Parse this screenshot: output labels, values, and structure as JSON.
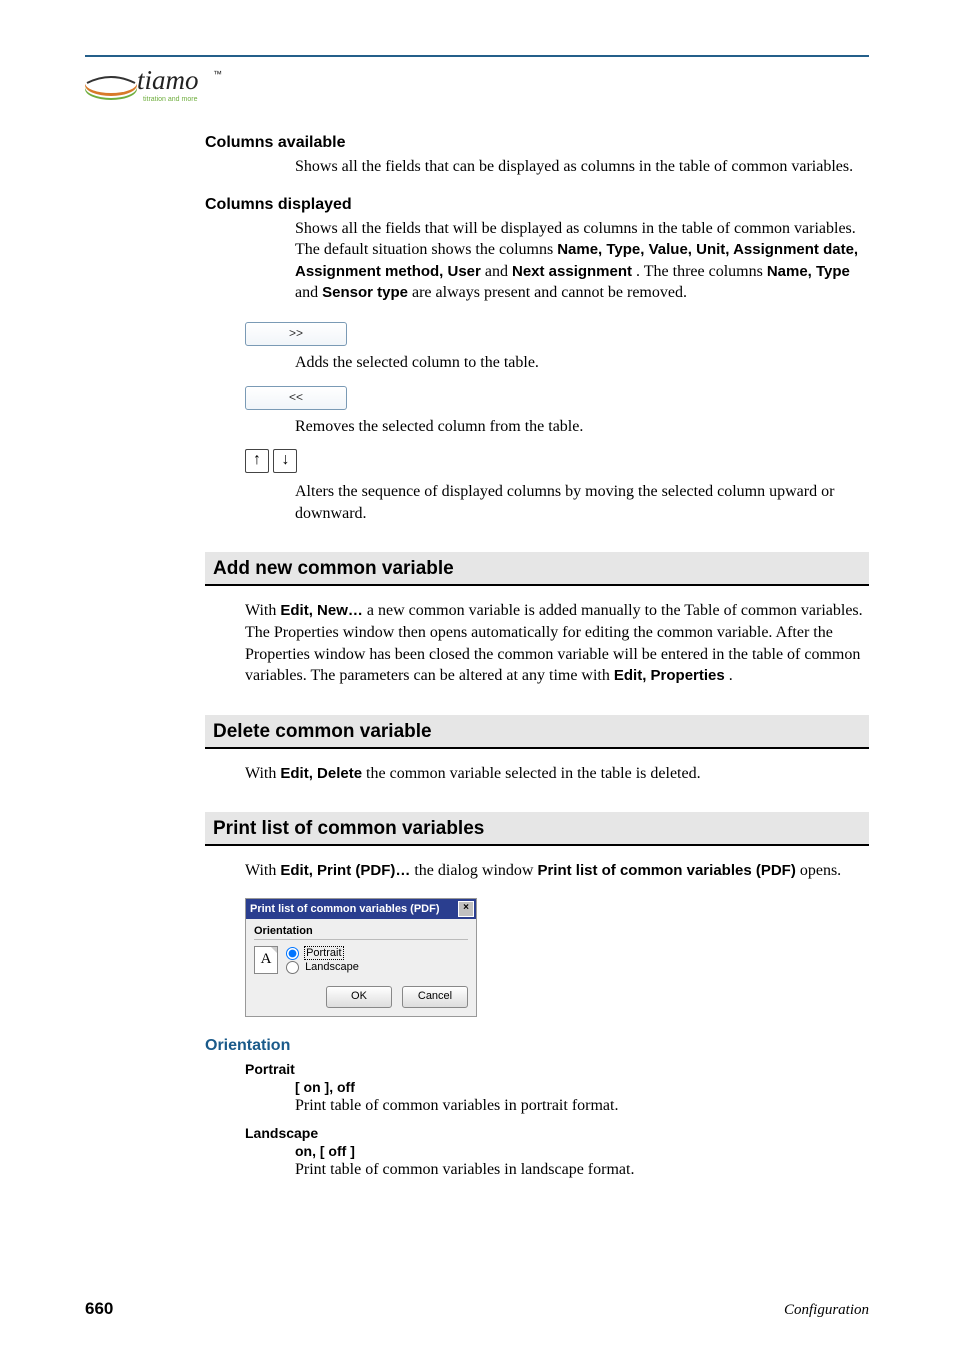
{
  "brand": {
    "name": "tiamo",
    "tagline": "titration and more",
    "tm": "™"
  },
  "columns_available": {
    "title": "Columns available",
    "body": "Shows all the fields that can be displayed as columns in the table of common variables."
  },
  "columns_displayed": {
    "title": "Columns displayed",
    "body_1": "Shows all the fields that will be displayed as columns in the table of common variables. The default situation shows the columns ",
    "bold_list": "Name, Type, Value, Unit, Assignment date, Assignment method, User",
    "body_2": " and ",
    "bold_next": "Next assignment",
    "body_3": ". The three columns ",
    "bold_fixed": "Name, Type",
    "body_4": " and ",
    "bold_sensor": "Sensor type",
    "body_5": " are always present and cannot be removed."
  },
  "btn_add": {
    "label": ">>",
    "desc": "Adds the selected column to the table."
  },
  "btn_remove": {
    "label": "<<",
    "desc": "Removes the selected column from the table."
  },
  "btn_move": {
    "up": "↑",
    "down": "↓",
    "desc": "Alters the sequence of displayed columns by moving the selected column upward or downward."
  },
  "section_add": {
    "title": "Add new common variable",
    "p1a": "With ",
    "p1_bold1": "Edit, New…",
    "p1b": " a new common variable is added manually to the Table of common variables. The Properties window then opens automatically for editing the common variable. After the Properties window has been closed the common variable will be entered in the table of common variables. The parameters can be altered at any time with ",
    "p1_bold2": "Edit, Properties",
    "p1c": "."
  },
  "section_delete": {
    "title": "Delete common variable",
    "p1a": "With ",
    "p1_bold": "Edit, Delete",
    "p1b": " the common variable selected in the table is deleted."
  },
  "section_print": {
    "title": "Print list of common variables",
    "p1a": "With ",
    "p1_bold1": "Edit, Print (PDF)…",
    "p1b": " the dialog window ",
    "p1_bold2": "Print list of common variables (PDF)",
    "p1c": " opens."
  },
  "dialog": {
    "title": "Print list of common variables (PDF)",
    "close": "×",
    "group": "Orientation",
    "icon_letter": "A",
    "opt_portrait": "Portrait",
    "opt_landscape": "Landscape",
    "ok": "OK",
    "cancel": "Cancel"
  },
  "orientation": {
    "title": "Orientation",
    "portrait": {
      "label": "Portrait",
      "value": "[ on ], off",
      "body": "Print table of common variables in portrait format."
    },
    "landscape": {
      "label": "Landscape",
      "value": "on, [ off ]",
      "body": "Print table of common variables in landscape format."
    }
  },
  "footer": {
    "page": "660",
    "section": "Configuration"
  }
}
